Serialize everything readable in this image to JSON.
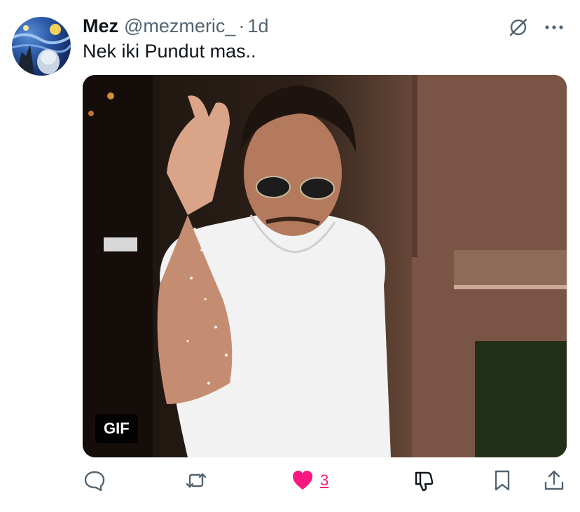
{
  "tweet": {
    "author": {
      "name": "Mez",
      "handle": "@mezmeric_",
      "time": "1d"
    },
    "text": "Nek iki Pundut mas..",
    "media": {
      "badge": "GIF"
    },
    "actions": {
      "like_count": "3"
    }
  },
  "colors": {
    "like": "#f91880",
    "secondary_text": "#536471",
    "primary_text": "#0f1419"
  },
  "icons": [
    "grok-icon",
    "more-icon",
    "reply-icon",
    "repost-icon",
    "heart-icon",
    "dislike-icon",
    "bookmark-icon",
    "share-icon"
  ]
}
